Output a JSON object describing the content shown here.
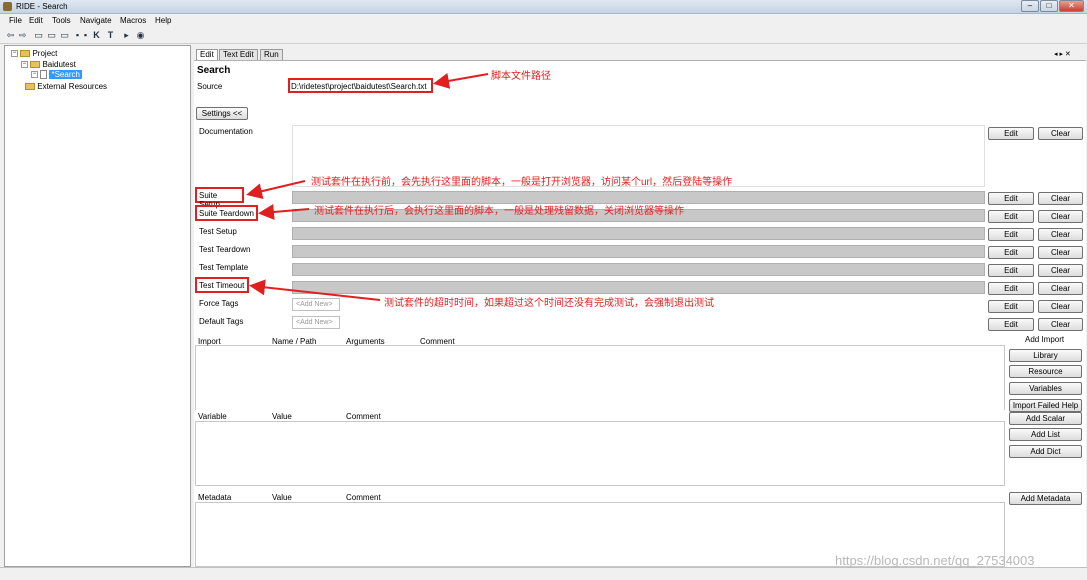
{
  "window": {
    "title": "RIDE - Search"
  },
  "menus": [
    "File",
    "Edit",
    "Tools",
    "Navigate",
    "Macros",
    "Help"
  ],
  "toolbar": [
    "back-icon",
    "forward-icon",
    "open-suite-icon",
    "open-dir-icon",
    "open-resource-icon",
    "save-icon",
    "save-all-icon",
    "search-keyword-icon",
    "search-test-icon",
    "run-icon",
    "stop-icon"
  ],
  "tree": {
    "root": "Project",
    "suite": "Baidutest",
    "file": "*Search",
    "external": "External Resources"
  },
  "tabs": [
    "Edit",
    "Text Edit",
    "Run"
  ],
  "suite": {
    "name": "Search",
    "source_label": "Source",
    "source_value": "D:\\ridetest\\project\\baidutest\\Search.txt"
  },
  "settings_button": "Settings <<",
  "settings": [
    {
      "label": "Documentation"
    },
    {
      "label": "Suite Setup"
    },
    {
      "label": "Suite Teardown"
    },
    {
      "label": "Test Setup"
    },
    {
      "label": "Test Teardown"
    },
    {
      "label": "Test Template"
    },
    {
      "label": "Test Timeout"
    },
    {
      "label": "Force Tags"
    },
    {
      "label": "Default Tags"
    }
  ],
  "edit_label": "Edit",
  "clear_label": "Clear",
  "add_new": "<Add New>",
  "import_table": {
    "headers": [
      "Import",
      "Name / Path",
      "Arguments",
      "Comment"
    ],
    "side_title": "Add Import",
    "buttons": [
      "Library",
      "Resource",
      "Variables",
      "Import Failed Help"
    ]
  },
  "variable_table": {
    "headers": [
      "Variable",
      "Value",
      "Comment"
    ],
    "buttons": [
      "Add Scalar",
      "Add List",
      "Add Dict"
    ]
  },
  "metadata_table": {
    "headers": [
      "Metadata",
      "Value",
      "Comment"
    ],
    "button": "Add Metadata"
  },
  "annotations": {
    "source": "脚本文件路径",
    "setup": "测试套件在执行前，会先执行这里面的脚本，一般是打开浏览器，访问某个url，然后登陆等操作",
    "teardown": "测试套件在执行后，会执行这里面的脚本，一般是处理残留数据，关闭浏览器等操作",
    "timeout": "测试套件的超时时间，如果超过这个时间还没有完成测试，会强制退出测试"
  },
  "watermark": "https://blog.csdn.net/qq_27534003",
  "colors": {
    "annotation": "#e02020",
    "selection": "#3399ff"
  }
}
